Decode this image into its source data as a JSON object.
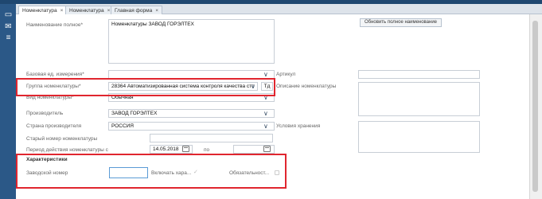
{
  "tabs": [
    {
      "label": "Номенклатура",
      "active": true
    },
    {
      "label": "Номенклатура",
      "active": false
    },
    {
      "label": "Главная форма",
      "active": false
    }
  ],
  "form": {
    "full_name_label": "Наименование полное*",
    "full_name_value": "Номенклатуры ЗАВОД ГОРЭЛТЕХ",
    "update_name_button": "Обновить полное наименование",
    "base_unit_label": "Базовая ед. измерения*",
    "base_unit_value": "",
    "article_label": "Артикул",
    "article_value": "",
    "group_label": "Группа номенклатуры*",
    "group_value": "28364   Автоматизированная система контроля качества сто",
    "group_extra": "Тд",
    "description_label": "Описание номенклатуры",
    "kind_label": "Вид номенклатуры*",
    "kind_value": "Обычная",
    "manufacturer_label": "Производитель",
    "manufacturer_value": "ЗАВОД ГОРЭЛТЕХ",
    "country_label": "Страна производителя",
    "country_value": "РОССИЯ",
    "storage_label": "Условия хранения",
    "old_number_label": "Старый номер номенклатуры",
    "old_number_value": "",
    "period_label": "Период действия номенклатуры с",
    "period_from": "14.05.2018",
    "period_to_label": "по",
    "period_to": ""
  },
  "characteristics": {
    "title": "Характеристики",
    "factory_number_label": "Заводской номер",
    "factory_number_value": "",
    "include_label": "Включать хара...",
    "required_label": "Обязательност..."
  },
  "colors": {
    "highlight": "#e0262f",
    "sidebar": "#2b5887"
  }
}
